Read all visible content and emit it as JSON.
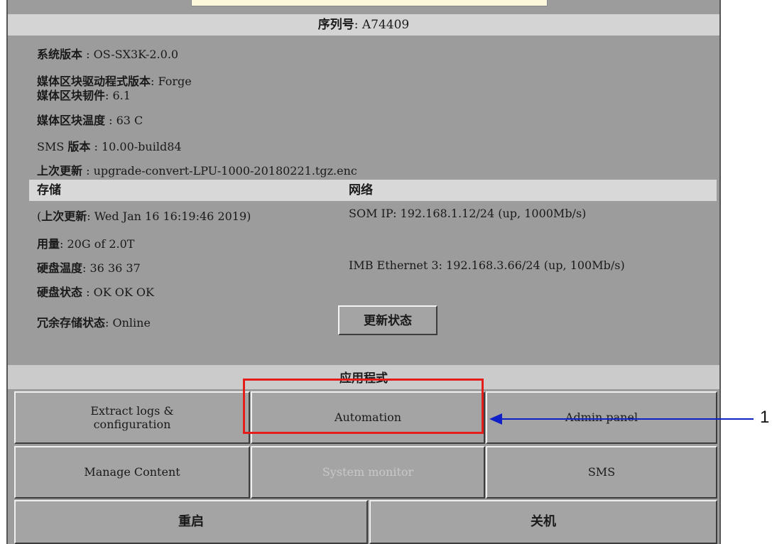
{
  "header": {
    "serial_label": "序列号",
    "serial_value": ": A74409"
  },
  "system_info": [
    {
      "label": "系统版本",
      "value": " : OS-SX3K-2.0.0"
    },
    {
      "label": "媒体区块驱动程式版本",
      "value": ": Forge"
    },
    {
      "label": "媒体区块韧件",
      "value": ": 6.1"
    },
    {
      "label": "媒体区块温度",
      "value": " : 63 C"
    },
    {
      "label_prefix": "SMS ",
      "label": "版本",
      "value": " : 10.00-build84"
    },
    {
      "label": "上次更新",
      "value": " : upgrade-convert-LPU-1000-20180221.tgz.enc"
    }
  ],
  "storage": {
    "heading": "存储",
    "last_update_open": "(",
    "last_update_label": "上次更新",
    "last_update_value": ": Wed Jan 16 16:19:46 2019)",
    "usage_label": "用量",
    "usage_value": ": 20G of 2.0T",
    "disk_temp_label": "硬盘温度",
    "disk_temp_value": ": 36 36 37",
    "disk_status_label": "硬盘状态",
    "disk_status_value": " : OK OK OK",
    "redundant_label": "冗余存储状态",
    "redundant_value": ": Online"
  },
  "network": {
    "heading": "网络",
    "som_ip": "SOM IP: 192.168.1.12/24 (up, 1000Mb/s)",
    "imb_ethernet": "IMB Ethernet 3: 192.168.3.66/24 (up, 100Mb/s)",
    "update_status_button": "更新状态"
  },
  "applications": {
    "heading": "应用程式",
    "extract_logs_line1": "Extract logs &",
    "extract_logs_line2": "configuration",
    "automation": "Automation",
    "admin_panel": "Admin panel",
    "manage_content": "Manage Content",
    "system_monitor": "System monitor",
    "sms": "SMS"
  },
  "power": {
    "reboot": "重启",
    "shutdown": "关机"
  },
  "annotation": {
    "callout_number": "1",
    "highlight_color": "#e41c1c",
    "arrow_color": "#1020c8"
  }
}
